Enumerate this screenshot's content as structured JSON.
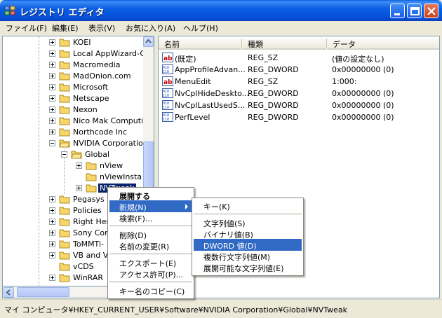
{
  "window": {
    "title": "レジストリ エディタ",
    "colors": {
      "titlebar": "#0b5fe3",
      "selection": "#316ac5",
      "tree_selection": "#0a246a"
    }
  },
  "menubar": {
    "items": [
      "ファイル(F)",
      "編集(E)",
      "表示(V)",
      "お気に入り(A)",
      "ヘルプ(H)"
    ]
  },
  "tree": {
    "items": [
      {
        "label": "KOEI",
        "expander": "plus"
      },
      {
        "label": "Local AppWizard-G",
        "expander": "plus"
      },
      {
        "label": "Macromedia",
        "expander": "plus"
      },
      {
        "label": "MadOnion.com",
        "expander": "plus"
      },
      {
        "label": "Microsoft",
        "expander": "plus"
      },
      {
        "label": "Netscape",
        "expander": "plus"
      },
      {
        "label": "Nexon",
        "expander": "plus"
      },
      {
        "label": "Nico Mak Computin",
        "expander": "plus"
      },
      {
        "label": "Northcode Inc",
        "expander": "plus"
      },
      {
        "label": "NVIDIA Corporation",
        "expander": "minus"
      },
      {
        "label": "Global",
        "expander": "minus"
      },
      {
        "label": "nView",
        "expander": "plus"
      },
      {
        "label": "nViewInsta",
        "expander": "none"
      },
      {
        "label": "NVTweak",
        "expander": "plus",
        "selected": true
      },
      {
        "label": "Pegasys",
        "expander": "plus"
      },
      {
        "label": "Policies",
        "expander": "plus"
      },
      {
        "label": "Right Her",
        "expander": "plus"
      },
      {
        "label": "Sony Cor",
        "expander": "plus"
      },
      {
        "label": "ToMMTi-",
        "expander": "plus"
      },
      {
        "label": "VB and V",
        "expander": "plus"
      },
      {
        "label": "vCDS",
        "expander": "none"
      },
      {
        "label": "WinRAR",
        "expander": "plus"
      }
    ]
  },
  "list": {
    "headers": [
      "名前",
      "種類",
      "データ"
    ],
    "rows": [
      {
        "icon": "string-value-icon",
        "name": "(既定)",
        "type": "REG_SZ",
        "data": "(値の設定なし)"
      },
      {
        "icon": "binary-value-icon",
        "name": "AppProfileAdvan...",
        "type": "REG_DWORD",
        "data": "0x00000000 (0)"
      },
      {
        "icon": "string-value-icon",
        "name": "MenuEdit",
        "type": "REG_SZ",
        "data": "1:000:"
      },
      {
        "icon": "binary-value-icon",
        "name": "NvCplHideDeskto...",
        "type": "REG_DWORD",
        "data": "0x00000000 (0)"
      },
      {
        "icon": "binary-value-icon",
        "name": "NvCplLastUsedS...",
        "type": "REG_DWORD",
        "data": "0x00000000 (0)"
      },
      {
        "icon": "binary-value-icon",
        "name": "PerfLevel",
        "type": "REG_DWORD",
        "data": "0x00000000 (0)"
      }
    ]
  },
  "context_menu": {
    "items": [
      "展開する",
      "新規(N)",
      "検索(F)...",
      "削除(D)",
      "名前の変更(R)",
      "エクスポート(E)",
      "アクセス許可(P)...",
      "キー名のコピー(C)"
    ]
  },
  "submenu": {
    "items": [
      "キー(K)",
      "文字列値(S)",
      "バイナリ値(B)",
      "DWORD 値(D)",
      "複数行文字列値(M)",
      "展開可能な文字列値(E)"
    ]
  },
  "status": {
    "path": "マイ コンピュータ¥HKEY_CURRENT_USER¥Software¥NVIDIA Corporation¥Global¥NVTweak"
  }
}
